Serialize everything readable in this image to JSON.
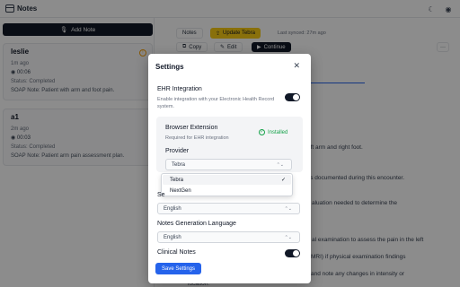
{
  "header": {
    "title": "Notes",
    "theme_icon": "moon-icon",
    "account_icon": "user-circle-icon"
  },
  "sidebar": {
    "add_note_label": "Add Note",
    "notes": [
      {
        "name": "leslie",
        "time": "1m ago",
        "duration": "00:06",
        "status": "Status: Completed",
        "summary": "SOAP Note: Patient with arm and foot pain.",
        "warning": true
      },
      {
        "name": "a1",
        "time": "2m ago",
        "duration": "00:03",
        "status": "Status: Completed",
        "summary": "SOAP Note: Patient arm pain assessment plan.",
        "warning": false
      }
    ]
  },
  "main": {
    "tab_notes": "Notes",
    "update_label": "Update Tebra",
    "last_synced": "Last synced: 27m ago",
    "copy_label": "Copy",
    "edit_label": "Edit",
    "continue_label": "Continue",
    "more_icon": "more-horizontal-icon",
    "bg_lines": [
      "oft arm and right foot.",
      "its documented during this encounter.",
      "aluation needed to determine the",
      "al examination to assess the pain in the left",
      "MRI) if physical examination findings",
      "and note any changes in intensity or",
      "location."
    ]
  },
  "modal": {
    "title": "Settings",
    "ehr_label": "EHR Integration",
    "ehr_desc": "Enable integration with your Electronic Health Record system.",
    "ehr_enabled": true,
    "ext_title": "Browser Extension",
    "ext_desc": "Required for EHR integration",
    "ext_status": "Installed",
    "provider_label": "Provider",
    "provider_value": "Tebra",
    "provider_options": [
      "Tebra",
      "NextGen"
    ],
    "provider_selected": "Tebra",
    "session_label_partial": "Se",
    "session_language_value": "English",
    "notes_lang_label": "Notes Generation Language",
    "notes_lang_value": "English",
    "clinical_notes_label": "Clinical Notes",
    "clinical_notes_enabled": true,
    "save_label": "Save Settings"
  },
  "colors": {
    "primary": "#111827",
    "accent_blue": "#2563eb",
    "tebra_yellow": "#facc15",
    "success": "#16a34a"
  }
}
